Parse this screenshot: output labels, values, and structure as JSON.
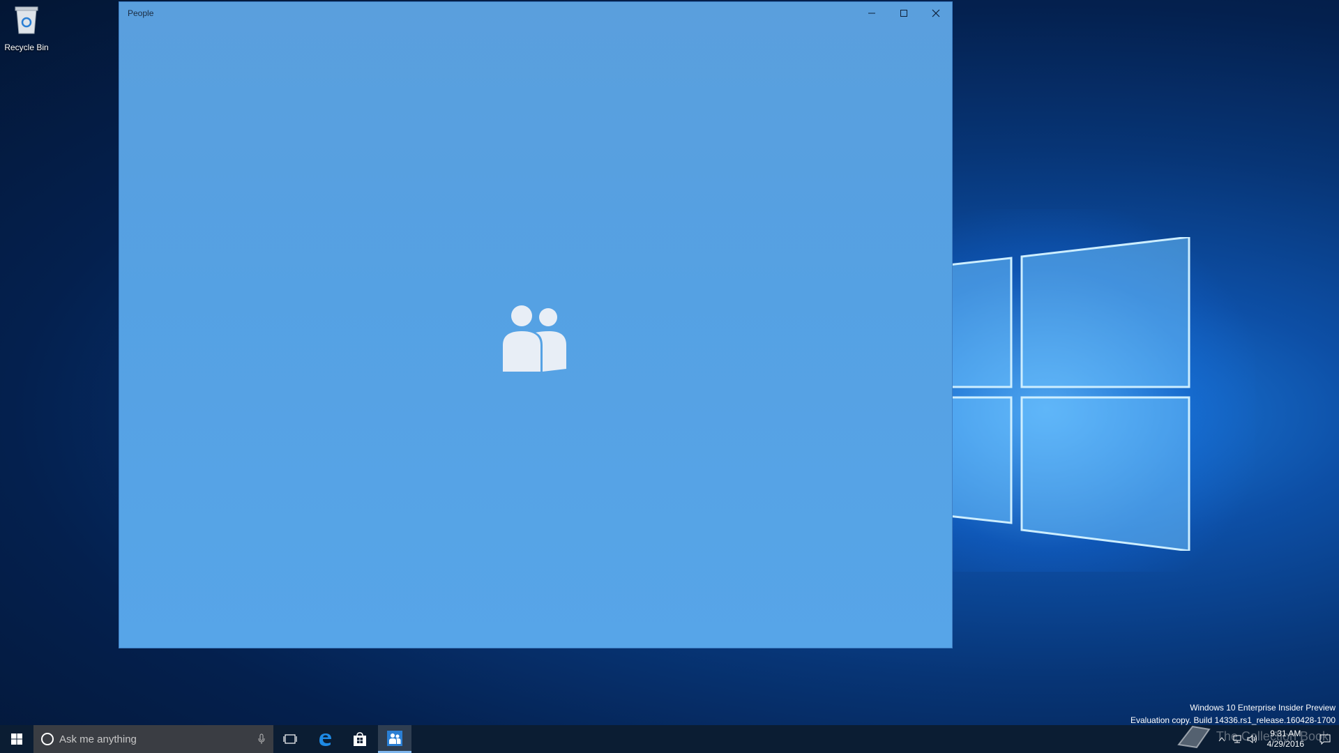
{
  "desktop": {
    "recycle_bin_label": "Recycle Bin"
  },
  "window": {
    "title": "People",
    "minimize_glyph": "—",
    "maximize_glyph": "☐",
    "close_glyph": "✕"
  },
  "watermark": {
    "line1": "Windows 10 Enterprise Insider Preview",
    "line2": "Evaluation copy. Build 14336.rs1_release.160428-1700",
    "site": "The Collection Book"
  },
  "taskbar": {
    "search_placeholder": "Ask me anything",
    "time": "9:31 AM",
    "date": "4/29/2016"
  },
  "colors": {
    "window_bg": "#57a5e8",
    "taskbar_bg": "#0b1d33",
    "accent": "#7fb7ee"
  }
}
